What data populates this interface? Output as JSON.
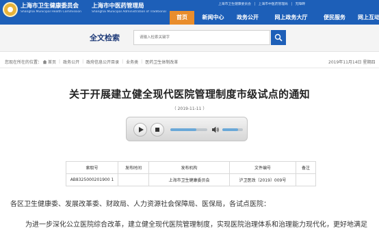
{
  "header": {
    "org1": "上海市卫生健康委员会",
    "org1_en": "Shanghai Municipal Health Commission",
    "org2": "上海市中医药管理局",
    "org2_en": "Shanghai Municipal Administration of Traditional Chinese Medicine",
    "top_links": [
      "上海市卫生健康委员会",
      "|",
      "上海市中医药管理局",
      "|",
      "无障碍"
    ],
    "nav": [
      "首页",
      "新闻中心",
      "政务公开",
      "网上政务大厅",
      "便民服务",
      "网上互动"
    ]
  },
  "search": {
    "title": "全文检索",
    "placeholder": "请输入检索关键字"
  },
  "breadcrumb": {
    "prefix": "您现在所在的位置：",
    "items": [
      "首页",
      "政务公开",
      "政府信息公开目录",
      "业务类",
      "医药卫生体制改革"
    ],
    "date": "2019年11月14日 星期四"
  },
  "document": {
    "title": "关于开展建立健全现代医院管理制度市级试点的通知",
    "date": "（ 2019-11-11 ）"
  },
  "audio": {
    "progress": 0.7,
    "volume": 0.75,
    "icons": [
      "play-icon",
      "stop-icon",
      "volume-icon"
    ]
  },
  "info_table": {
    "headers": [
      "索取号",
      "发布时间",
      "发布机构",
      "文件编号",
      "备注"
    ],
    "row": [
      "AB8325000201900 1",
      "",
      "上海市卫生健康委员会",
      "沪卫医改〔2019〕009号",
      ""
    ]
  },
  "body": {
    "p1": "各区卫生健康委、发展改革委、财政局、人力资源社会保障局、医保局，各试点医院：",
    "p2": "为进一步深化公立医院综合改革，建立健全现代医院管理制度，实现医院治理体系和治理能力现代化，更好地满足"
  },
  "colors": {
    "header_blue": "#1d5fb8",
    "nav_active": "#e98d2c"
  }
}
